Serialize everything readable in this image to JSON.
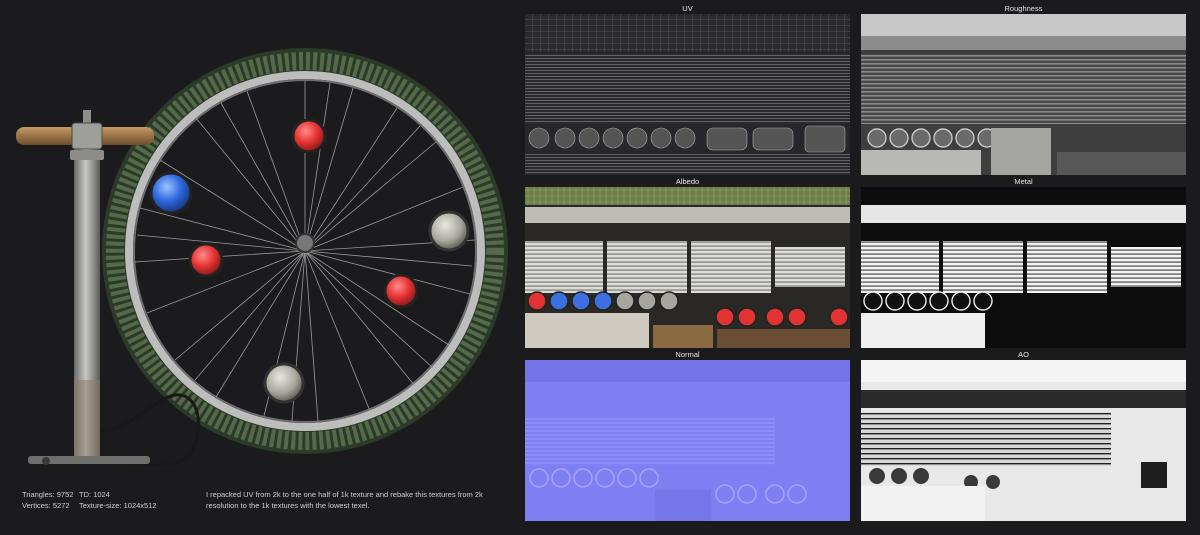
{
  "stats": {
    "triangles": "Triangles: 9752",
    "vertices": "Vertices: 5272",
    "td": "TD: 1024",
    "texture_size": "Texture-size: 1024x512"
  },
  "note": "I repacked UV from 2k to the one half of 1k texture and rebake this textures from 2k resolution to the 1k textures with the lowest texel.",
  "panels": {
    "uv": "UV",
    "roughness": "Roughness",
    "albedo": "Albedo",
    "metal": "Metal",
    "normal": "Normal",
    "ao": "AO"
  },
  "colors": {
    "background": "#1b1b1e",
    "tire": "#5c6e4c",
    "rim": "#b6b6b6",
    "reflector_red": "#e83a3a",
    "reflector_blue": "#3a78e8",
    "normal_base": "#7e7ff5"
  }
}
